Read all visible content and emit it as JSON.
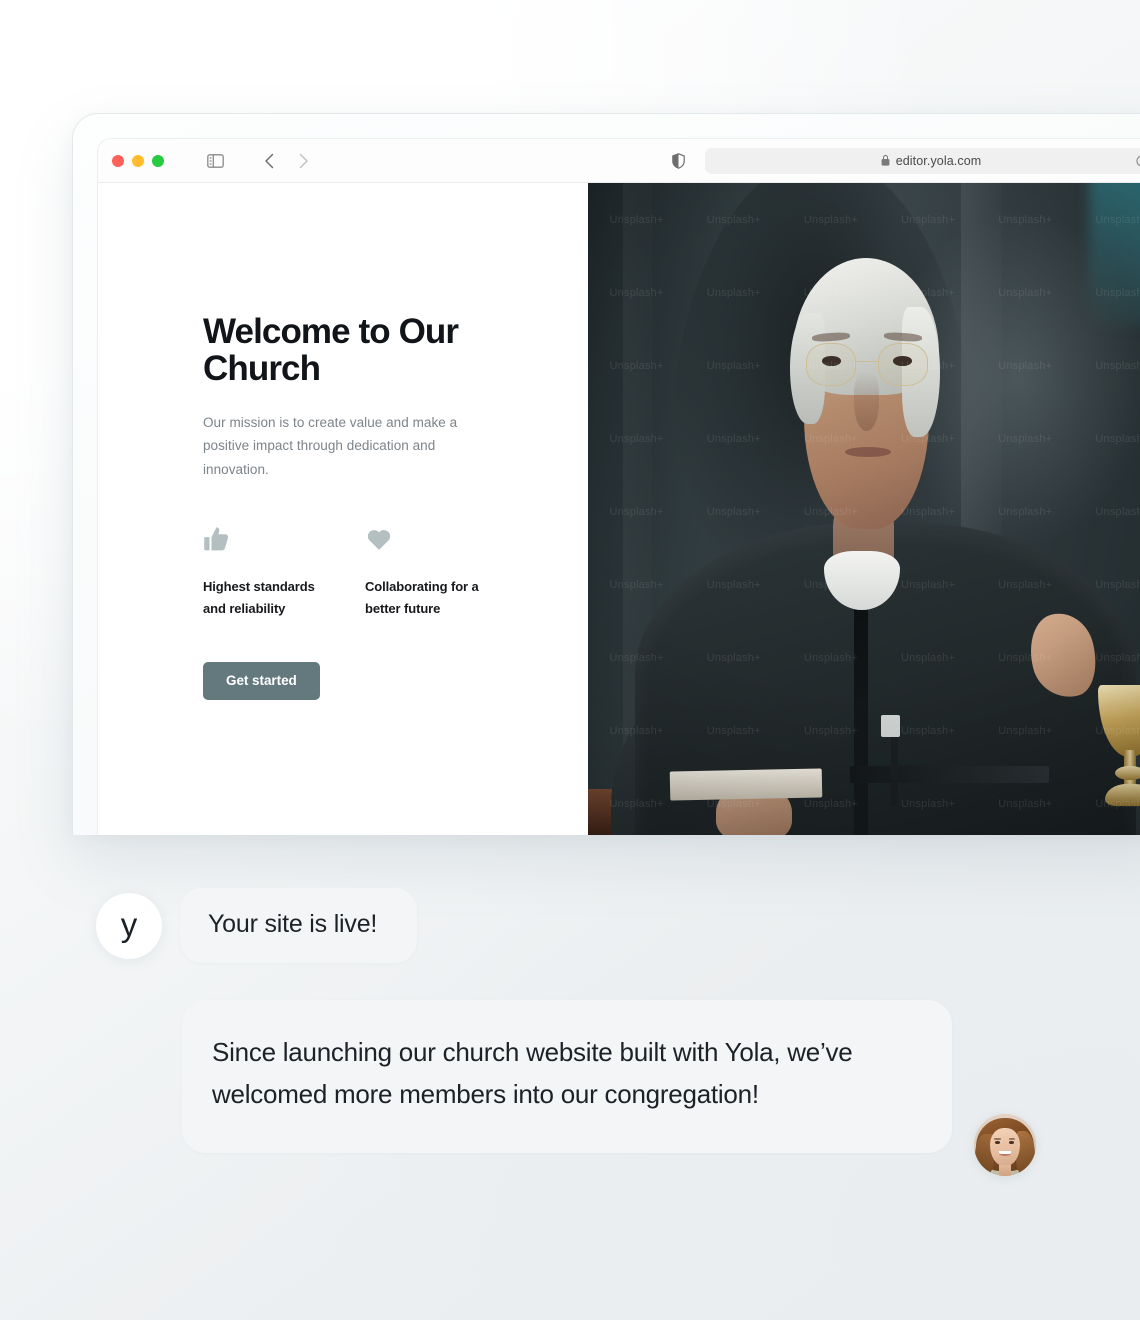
{
  "browser": {
    "traffic_lights": [
      {
        "name": "close",
        "color": "#ff6058"
      },
      {
        "name": "minimize",
        "color": "#ffbd2e"
      },
      {
        "name": "maximize",
        "color": "#28ca42"
      }
    ],
    "sidebar_toggle_icon": "sidebar-toggle-icon",
    "back_icon": "chevron-left-icon",
    "forward_icon": "chevron-right-icon",
    "shield_icon": "shield-icon",
    "lock_icon": "lock-icon",
    "reload_icon": "reload-icon",
    "url": "editor.yola.com"
  },
  "hero": {
    "heading": "Welcome to Our Church",
    "subtext": "Our mission is to create value and make a positive impact through dedication and innovation.",
    "features": [
      {
        "icon": "thumbs-up-icon",
        "label": "Highest standards and reliability"
      },
      {
        "icon": "heart-icon",
        "label": "Collaborating for a better future"
      }
    ],
    "cta_label": "Get started",
    "cta_color": "#64797e",
    "icon_color": "#b4bfc2",
    "photo_alt": "priest-speaking-photo",
    "photo_watermark": "Unsplash+"
  },
  "chat": {
    "brand_initial": "y",
    "message_1": "Your site is live!",
    "message_2": "Since launching our church website built with Yola, we’ve welcomed more members into our congregation!",
    "person_avatar": "smiling-woman-avatar"
  },
  "theme": {
    "bubble_bg": "#f4f5f6",
    "text": "#1d2228",
    "page_bg": "#eceff1"
  }
}
